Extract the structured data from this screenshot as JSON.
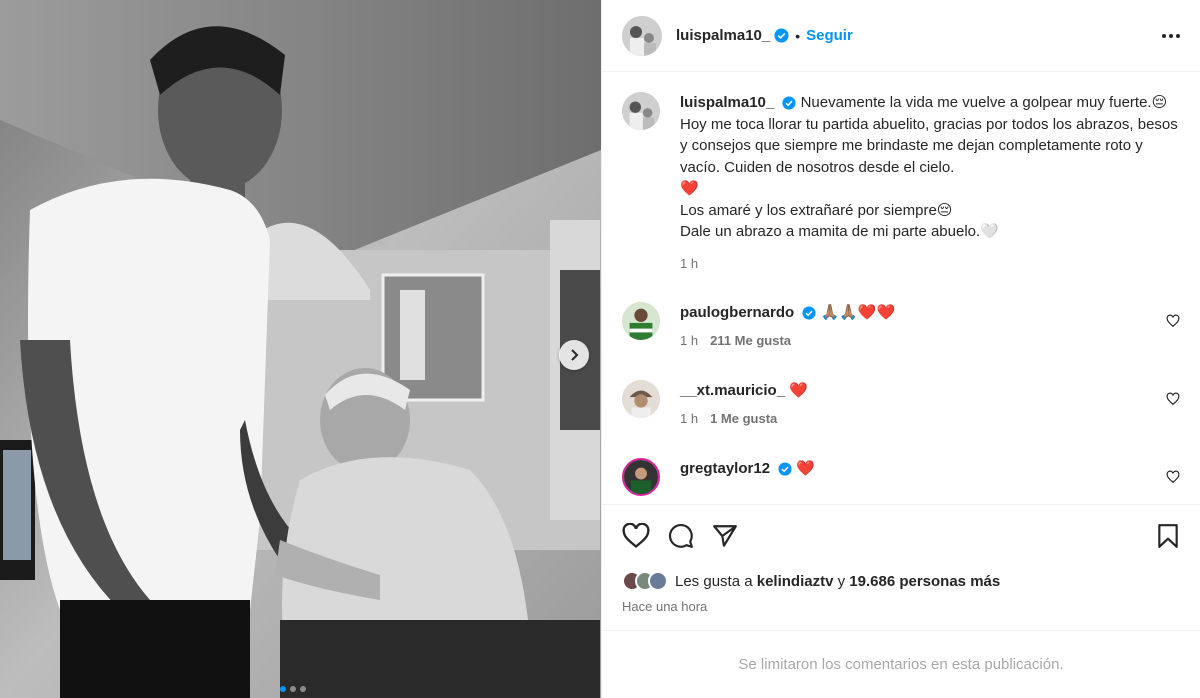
{
  "post": {
    "username": "luispalma10_",
    "follow_label": "Seguir",
    "caption_lines": [
      "Nuevamente la vida me vuelve a golpear muy fuerte.😔",
      "Hoy me toca llorar tu partida abuelito, gracias por todos los abrazos, besos y consejos que siempre me brindaste me dejan completamente roto y vacío. Cuiden de nosotros desde el cielo.",
      "❤️",
      "Los amaré y los extrañaré por siempre😔",
      "Dale un abrazo a mamita de mi parte abuelo.🤍"
    ],
    "caption_time": "1 h"
  },
  "comments": [
    {
      "username": "paulogbernardo",
      "text": "🙏🏽🙏🏽❤️❤️",
      "time": "1 h",
      "likes": "211 Me gusta",
      "verified": true
    },
    {
      "username": "__xt.mauricio_",
      "text": "❤️",
      "time": "1 h",
      "likes": "1 Me gusta",
      "verified": false
    },
    {
      "username": "gregtaylor12",
      "text": "❤️",
      "time": "",
      "likes": "",
      "verified": true
    }
  ],
  "likes_bar": {
    "prefix": "Les gusta a",
    "user": "kelindiaztv",
    "connector": "y",
    "others": "19.686 personas más"
  },
  "timestamp": "Hace una hora",
  "comments_limited": "Se limitaron los comentarios en esta publicación.",
  "icons": {
    "like": "heart-outline-icon",
    "comment": "comment-icon",
    "share": "share-paper-plane-icon",
    "save": "bookmark-icon",
    "next": "chevron-right-icon"
  },
  "colors": {
    "accent": "#0095f6",
    "verified": "#0095f6",
    "heart": "#e0245e"
  },
  "carousel": {
    "count": 3,
    "active": 1
  }
}
